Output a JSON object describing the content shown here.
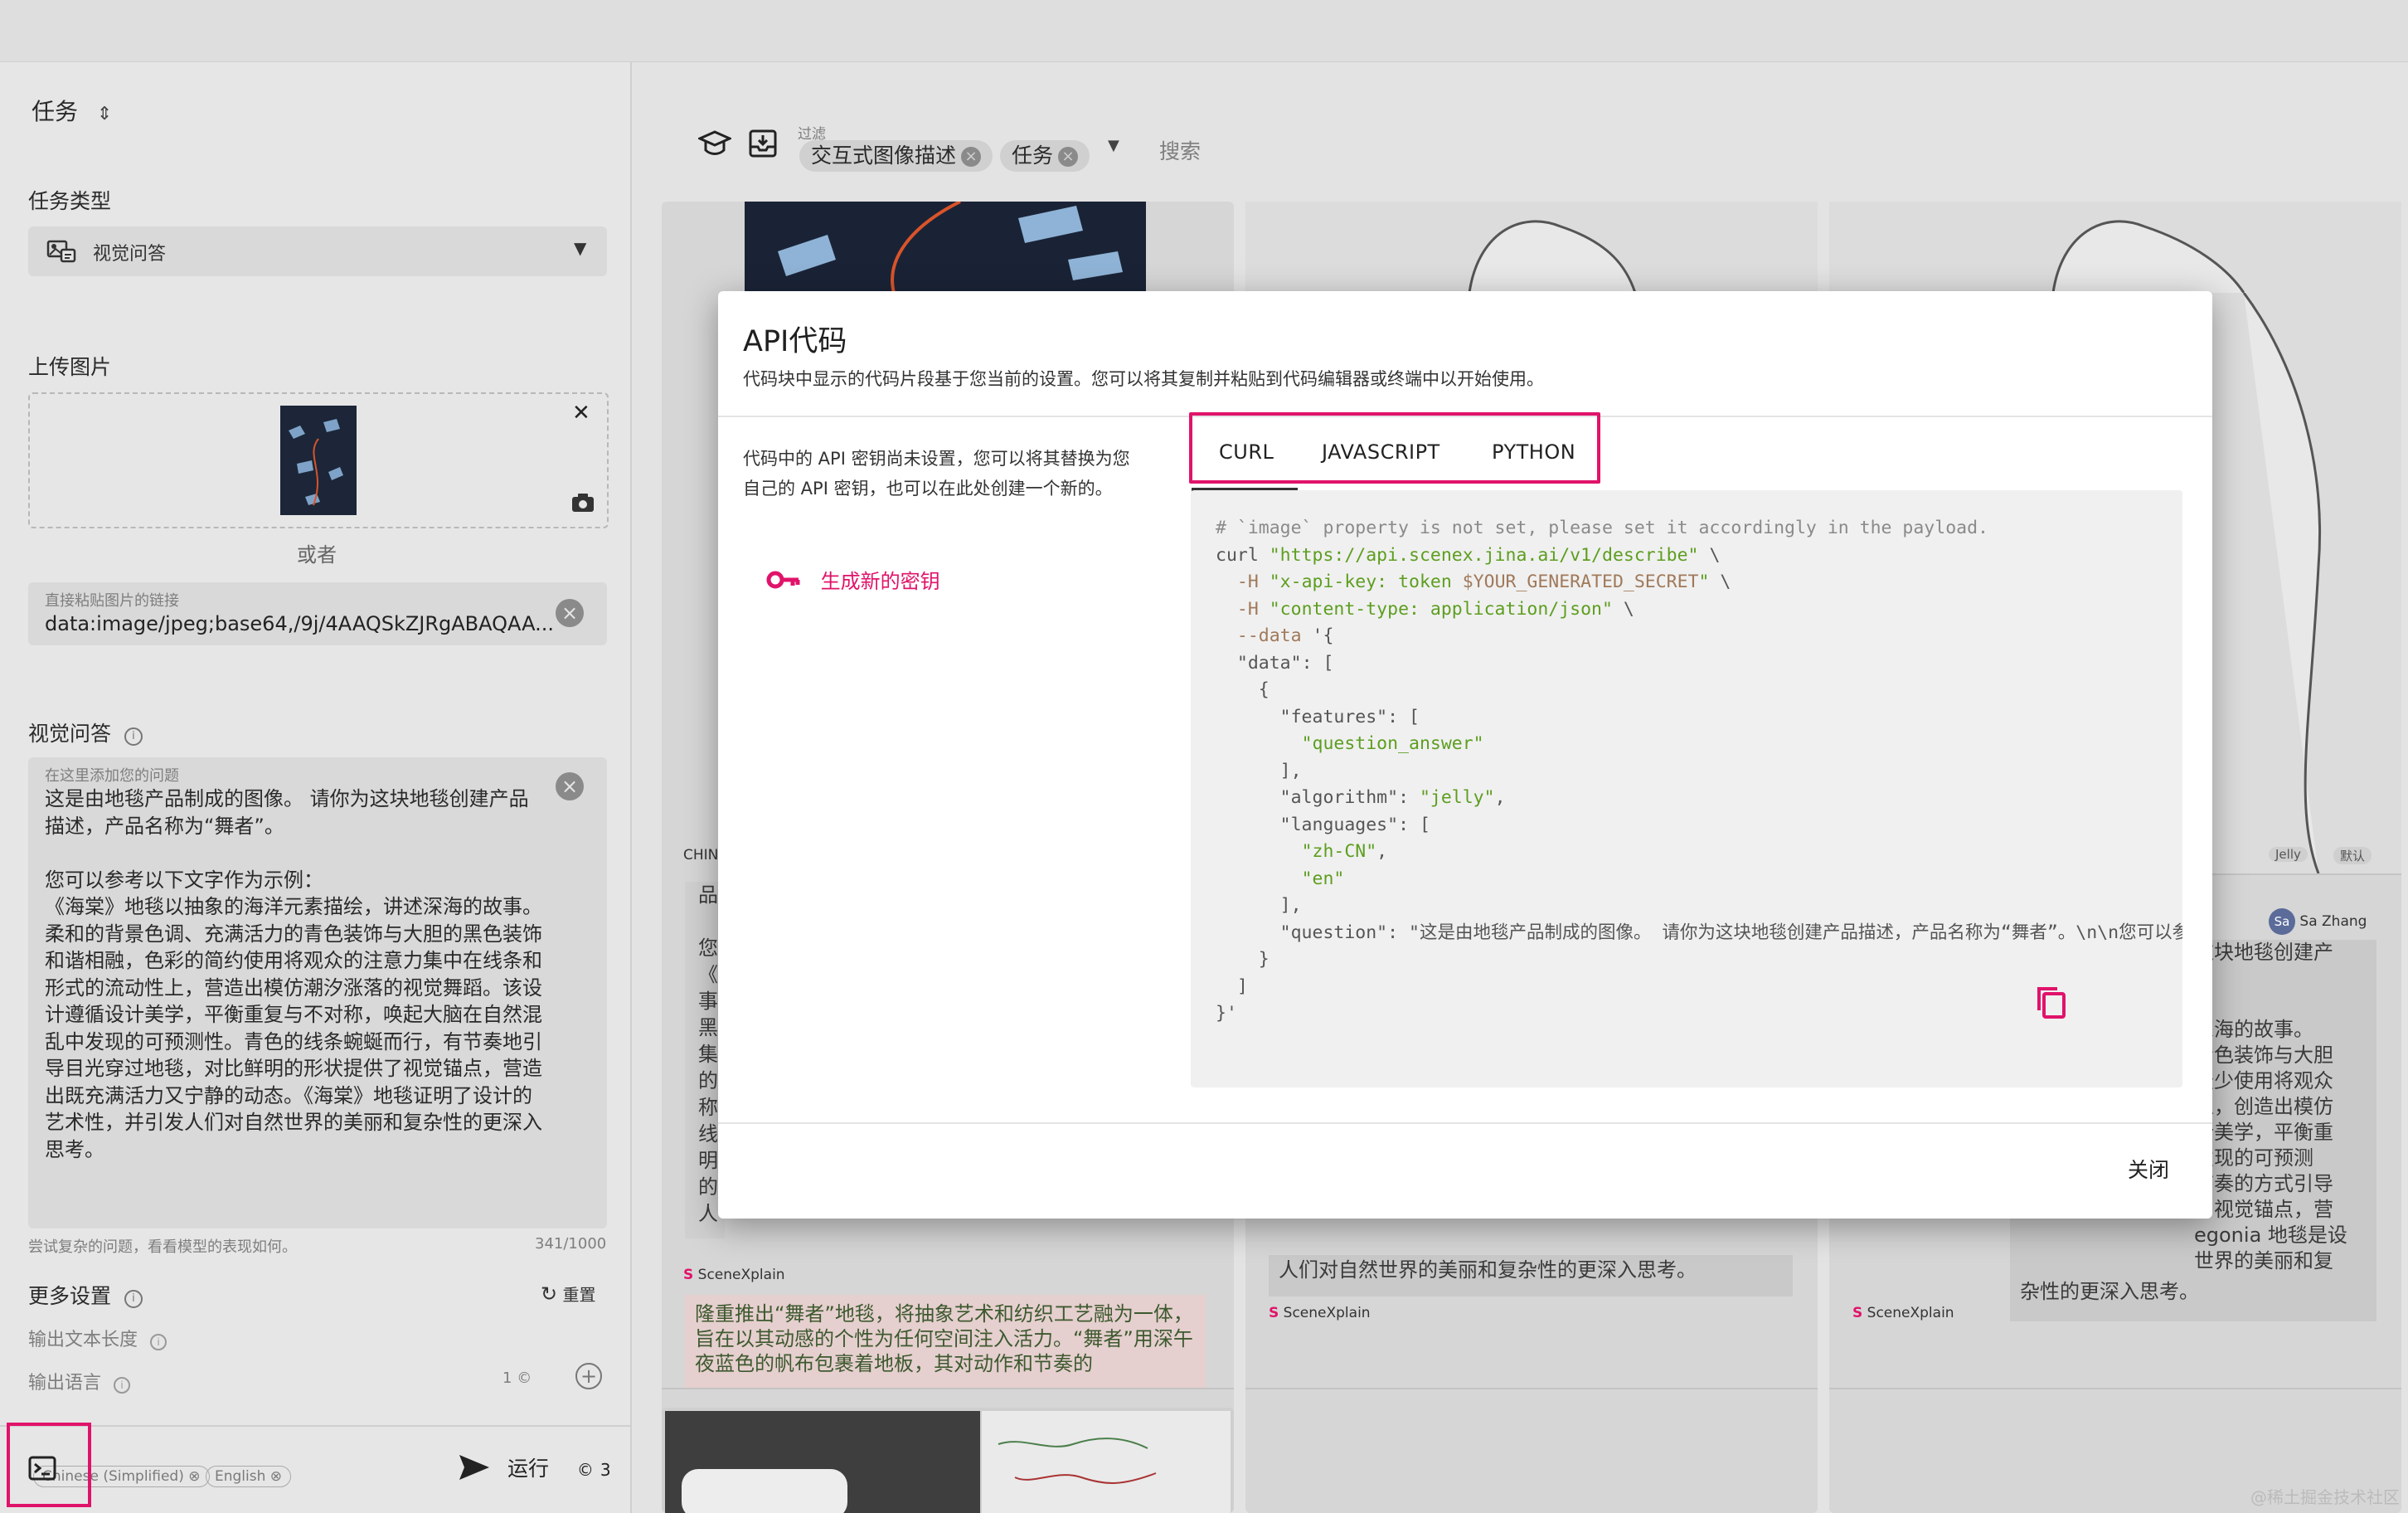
{
  "sidebar": {
    "task_title": "任务",
    "task_type_label": "任务类型",
    "task_type_value": "视觉问答",
    "upload_label": "上传图片",
    "or_text": "或者",
    "url_label": "直接粘贴图片的链接",
    "url_value": "data:image/jpeg;base64,/9j/4AAQSkZJRgABAQAA...",
    "vqa_label": "视觉问答",
    "question_placeholder": "在这里添加您的问题",
    "question_text": "这是由地毯产品制成的图像。 请你为这块地毯创建产品描述，产品名称为“舞者”。\n\n您可以参考以下文字作为示例：\n《海棠》地毯以抽象的海洋元素描绘，讲述深海的故事。柔和的背景色调、充满活力的青色装饰与大胆的黑色装饰和谐相融，色彩的简约使用将观众的注意力集中在线条和形式的流动性上，营造出模仿潮汐涨落的视觉舞蹈。该设计遵循设计美学，平衡重复与不对称，唤起大脑在自然混乱中发现的可预测性。青色的线条蜿蜒而行，有节奏地引导目光穿过地毯，对比鲜明的形状提供了视觉锚点，营造出既充满活力又宁静的动态。《海棠》地毯证明了设计的艺术性，并引发人们对自然世界的美丽和复杂性的更深入思考。",
    "question_hint": "尝试复杂的问题，看看模型的表现如何。",
    "char_count": "341/1000",
    "more_settings": "更多设置",
    "reset": "重置",
    "output_length": "输出文本长度",
    "output_language": "输出语言",
    "lang_count": "1",
    "lang_chips": [
      "Chinese (Simplified)",
      "English"
    ],
    "run_label": "运行",
    "run_cost": "3"
  },
  "toolbar": {
    "filter_label": "过滤",
    "chips": [
      "交互式图像描述",
      "任务"
    ],
    "search_placeholder": "搜索"
  },
  "cards": [
    {
      "snippet_title": "CHIN",
      "side_text": [
        "品",
        "",
        "您",
        "《",
        "事",
        "黑",
        "集",
        "的",
        "称",
        "线",
        "明",
        "的",
        "人"
      ],
      "source": "SceneXplain",
      "answer": "隆重推出“舞者”地毯，将抽象艺术和纺织工艺融为一体，旨在以其动感的个性为任何空间注入活力。“舞者”用深午夜蓝色的帆布包裹着地板，其对动作和节奏的"
    },
    {
      "source": "SceneXplain",
      "answer_tail": "人们对自然世界的美丽和复杂性的更深入思考。"
    },
    {
      "tags": [
        "Jelly",
        "默认"
      ],
      "user": "Sa Zhang",
      "user_initials": "Sa",
      "side_text": [
        "这块地毯创建产",
        "",
        "",
        "深海的故事。",
        "青色装饰与大胆",
        "最少使用将观众",
        "上，创造出模仿",
        "计美学，平衡重",
        "发现的可预测",
        "节奏的方式引导",
        "了视觉锚点，营",
        "egonia 地毯是设",
        "世界的美丽和复"
      ],
      "answer_tail": "杂性的更深入思考。",
      "source": "SceneXplain"
    }
  ],
  "modal": {
    "title": "API代码",
    "description": "代码块中显示的代码片段基于您当前的设置。您可以将其复制并粘贴到代码编辑器或终端中以开始使用。",
    "key_note": "代码中的 API 密钥尚未设置，您可以将其替换为您自己的 API 密钥，也可以在此处创建一个新的。",
    "generate_key": "生成新的密钥",
    "tabs": [
      "CURL",
      "JAVASCRIPT",
      "PYTHON"
    ],
    "active_tab": "CURL",
    "code_lines": [
      "# `image` property is not set, please set it accordingly in the payload.",
      "curl \"https://api.scenex.jina.ai/v1/describe\" \\",
      "  -H \"x-api-key: token $YOUR_GENERATED_SECRET\" \\",
      "  -H \"content-type: application/json\" \\",
      "  --data '{",
      "  \"data\": [",
      "    {",
      "      \"features\": [",
      "        \"question_answer\"",
      "      ],",
      "      \"algorithm\": \"jelly\",",
      "      \"languages\": [",
      "        \"zh-CN\",",
      "        \"en\"",
      "      ],",
      "      \"question\": \"这是由地毯产品制成的图像。 请你为这块地毯创建产品描述，产品名称为“舞者”。\\n\\n您可以参",
      "    }",
      "  ]",
      "}'"
    ],
    "close_label": "关闭"
  },
  "colors": {
    "accent": "#e0136a",
    "code_string": "#5d9e1f",
    "code_variable": "#a0795a",
    "code_comment": "#8a8a8a"
  },
  "watermark": "@稀土掘金技术社区"
}
